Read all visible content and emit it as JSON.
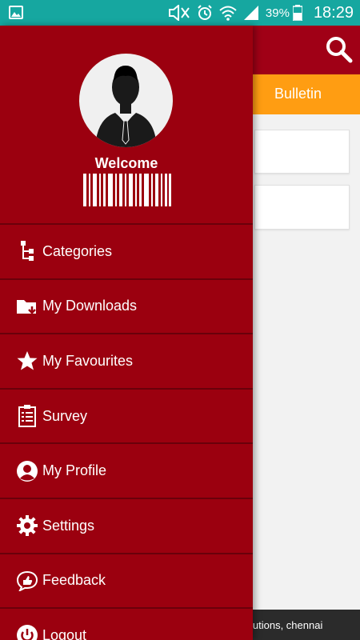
{
  "status_bar": {
    "battery_percent": "39%",
    "time": "18:29"
  },
  "background_app": {
    "tab_label": "Bulletin",
    "footer_text": "lutions, chennai"
  },
  "drawer": {
    "welcome_text": "Welcome",
    "menu": [
      {
        "label": "Categories",
        "icon": "categories-tree-icon"
      },
      {
        "label": "My Downloads",
        "icon": "downloads-folder-icon"
      },
      {
        "label": "My Favourites",
        "icon": "star-icon"
      },
      {
        "label": "Survey",
        "icon": "clipboard-icon"
      },
      {
        "label": "My Profile",
        "icon": "profile-icon"
      },
      {
        "label": "Settings",
        "icon": "gear-icon"
      },
      {
        "label": "Feedback",
        "icon": "feedback-icon"
      },
      {
        "label": "Logout",
        "icon": "power-icon"
      }
    ]
  },
  "colors": {
    "status_bar": "#16a7a0",
    "drawer_background": "#9b000f",
    "tab_strip": "#ff9d12",
    "toolbar": "#a00016"
  }
}
